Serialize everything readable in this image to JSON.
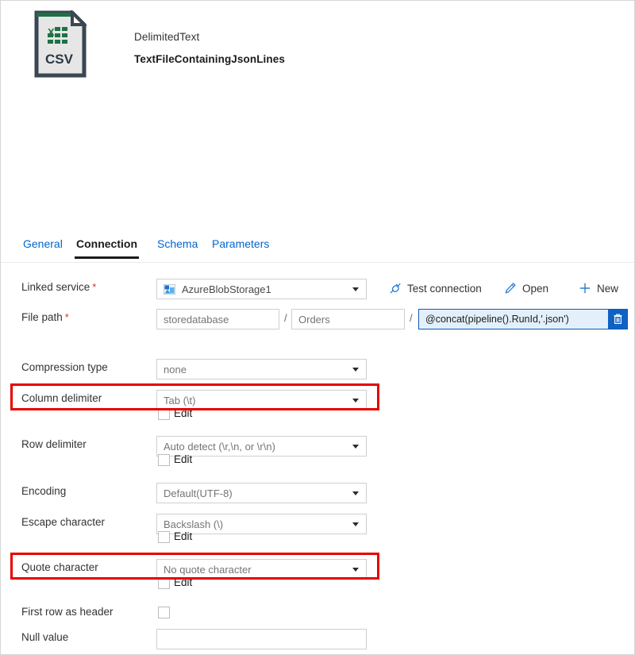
{
  "header": {
    "icon": "csv-file-icon",
    "icon_label": "CSV",
    "type": "DelimitedText",
    "name": "TextFileContainingJsonLines"
  },
  "tabs": [
    {
      "label": "General",
      "active": false
    },
    {
      "label": "Connection",
      "active": true
    },
    {
      "label": "Schema",
      "active": false
    },
    {
      "label": "Parameters",
      "active": false
    }
  ],
  "form": {
    "linked_service": {
      "label": "Linked service",
      "required": "*",
      "value": "AzureBlobStorage1",
      "icon": "azure-blob-storage-icon",
      "actions": [
        {
          "label": "Test connection",
          "icon": "plug-icon"
        },
        {
          "label": "Open",
          "icon": "pencil-icon"
        },
        {
          "label": "New",
          "icon": "plus-icon"
        }
      ]
    },
    "file_path": {
      "label": "File path",
      "required": "*",
      "container": "storedatabase",
      "directory": "Orders",
      "separator": "/",
      "file_expression": "@concat(pipeline().RunId,'.json')",
      "delete_icon": "trash-icon"
    },
    "compression_type": {
      "label": "Compression type",
      "value": "none"
    },
    "column_delimiter": {
      "label": "Column delimiter",
      "value": "Tab (\\t)",
      "edit_label": "Edit",
      "edit_checked": false,
      "highlighted": true
    },
    "row_delimiter": {
      "label": "Row delimiter",
      "value": "Auto detect (\\r,\\n, or \\r\\n)",
      "edit_label": "Edit",
      "edit_checked": false
    },
    "encoding": {
      "label": "Encoding",
      "value": "Default(UTF-8)"
    },
    "escape_character": {
      "label": "Escape character",
      "value": "Backslash (\\)",
      "edit_label": "Edit",
      "edit_checked": false
    },
    "quote_character": {
      "label": "Quote character",
      "value": "No quote character",
      "edit_label": "Edit",
      "edit_checked": false,
      "highlighted": true
    },
    "first_row_as_header": {
      "label": "First row as header",
      "checked": false
    },
    "null_value": {
      "label": "Null value",
      "value": ""
    }
  },
  "colors": {
    "link": "#0066cc",
    "required": "#d13438",
    "highlight_box": "#e60000",
    "dynamic_field_border": "#0b5cb5",
    "dynamic_field_bg": "#e3f0fb",
    "delete_button": "#0f62c4",
    "icon_green": "#1e7145",
    "icon_outline": "#3a4651"
  }
}
